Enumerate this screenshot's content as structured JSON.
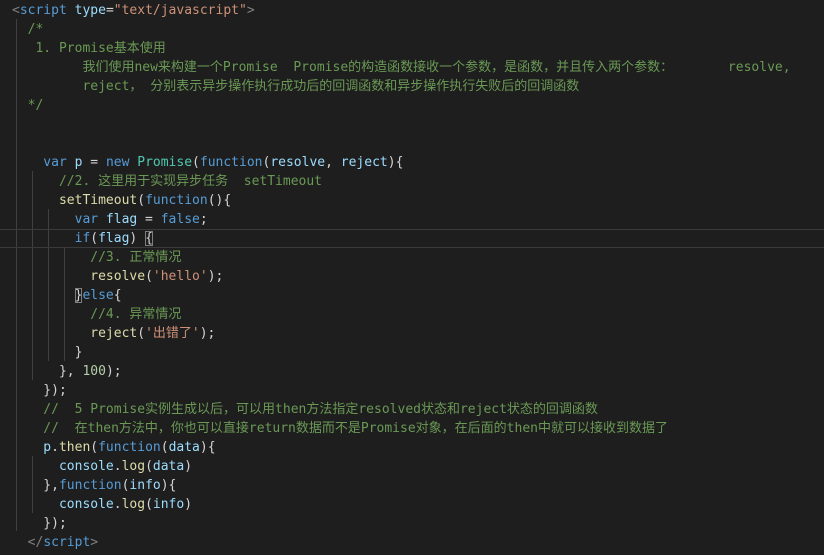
{
  "editor": {
    "language": "javascript",
    "theme": "dark",
    "colors": {
      "background": "#1e1e1e",
      "keyword": "#569cd6",
      "variable": "#9cdcfe",
      "function": "#dcdcaa",
      "class": "#4ec9b0",
      "string": "#ce9178",
      "number": "#b5cea8",
      "comment": "#6a9955",
      "text": "#d4d4d4"
    },
    "lines": [
      {
        "n": 1,
        "tokens": [
          [
            "tk-punc",
            "<"
          ],
          [
            "tk-tag",
            "script"
          ],
          [
            "tk-plain",
            " "
          ],
          [
            "tk-attr",
            "type"
          ],
          [
            "tk-plain",
            "="
          ],
          [
            "tk-str",
            "\"text/javascript\""
          ],
          [
            "tk-punc",
            ">"
          ]
        ]
      },
      {
        "n": 2,
        "tokens": [
          [
            "tk-cmt",
            "  /*"
          ]
        ]
      },
      {
        "n": 3,
        "tokens": [
          [
            "tk-cmt",
            "   1. Promise基本使用"
          ]
        ]
      },
      {
        "n": 4,
        "tokens": [
          [
            "tk-cmt",
            "         我们使用new来构建一个Promise  Promise的构造函数接收一个参数，是函数，并且传入两个参数：       resolve,"
          ]
        ]
      },
      {
        "n": 5,
        "tokens": [
          [
            "tk-cmt",
            "         reject， 分别表示异步操作执行成功后的回调函数和异步操作执行失败后的回调函数"
          ]
        ]
      },
      {
        "n": 6,
        "tokens": [
          [
            "tk-cmt",
            "  */"
          ]
        ]
      },
      {
        "n": 7,
        "tokens": []
      },
      {
        "n": 8,
        "tokens": []
      },
      {
        "n": 9,
        "tokens": [
          [
            "tk-kw",
            "    var"
          ],
          [
            "tk-plain",
            " "
          ],
          [
            "tk-var",
            "p"
          ],
          [
            "tk-plain",
            " = "
          ],
          [
            "tk-kw",
            "new"
          ],
          [
            "tk-plain",
            " "
          ],
          [
            "tk-cls",
            "Promise"
          ],
          [
            "tk-plain",
            "("
          ],
          [
            "tk-kw",
            "function"
          ],
          [
            "tk-plain",
            "("
          ],
          [
            "tk-var",
            "resolve"
          ],
          [
            "tk-plain",
            ", "
          ],
          [
            "tk-var",
            "reject"
          ],
          [
            "tk-plain",
            "){"
          ]
        ]
      },
      {
        "n": 10,
        "tokens": [
          [
            "tk-cmt",
            "      //2. 这里用于实现异步任务  setTimeout"
          ]
        ]
      },
      {
        "n": 11,
        "tokens": [
          [
            "tk-fn",
            "      setTimeout"
          ],
          [
            "tk-plain",
            "("
          ],
          [
            "tk-kw",
            "function"
          ],
          [
            "tk-plain",
            "(){"
          ]
        ]
      },
      {
        "n": 12,
        "tokens": [
          [
            "tk-kw",
            "        var"
          ],
          [
            "tk-plain",
            " "
          ],
          [
            "tk-var",
            "flag"
          ],
          [
            "tk-plain",
            " = "
          ],
          [
            "tk-bool",
            "false"
          ],
          [
            "tk-plain",
            ";"
          ]
        ]
      },
      {
        "n": 13,
        "current": true,
        "tokens": [
          [
            "tk-kw",
            "        if"
          ],
          [
            "tk-plain",
            "("
          ],
          [
            "tk-var",
            "flag"
          ],
          [
            "tk-plain",
            ") "
          ],
          [
            "tk-plain box",
            "{"
          ]
        ]
      },
      {
        "n": 14,
        "tokens": [
          [
            "tk-cmt",
            "          //3. 正常情况"
          ]
        ]
      },
      {
        "n": 15,
        "tokens": [
          [
            "tk-fn",
            "          resolve"
          ],
          [
            "tk-plain",
            "("
          ],
          [
            "tk-str",
            "'hello'"
          ],
          [
            "tk-plain",
            ");"
          ]
        ]
      },
      {
        "n": 16,
        "tokens": [
          [
            "tk-plain",
            "        "
          ],
          [
            "tk-plain box",
            "}"
          ],
          [
            "tk-kw",
            "else"
          ],
          [
            "tk-plain",
            "{"
          ]
        ]
      },
      {
        "n": 17,
        "tokens": [
          [
            "tk-cmt",
            "          //4. 异常情况"
          ]
        ]
      },
      {
        "n": 18,
        "tokens": [
          [
            "tk-fn",
            "          reject"
          ],
          [
            "tk-plain",
            "("
          ],
          [
            "tk-str",
            "'出错了'"
          ],
          [
            "tk-plain",
            ");"
          ]
        ]
      },
      {
        "n": 19,
        "tokens": [
          [
            "tk-plain",
            "        }"
          ]
        ]
      },
      {
        "n": 20,
        "tokens": [
          [
            "tk-plain",
            "      }, "
          ],
          [
            "tk-num",
            "100"
          ],
          [
            "tk-plain",
            ");"
          ]
        ]
      },
      {
        "n": 21,
        "tokens": [
          [
            "tk-plain",
            "    });"
          ]
        ]
      },
      {
        "n": 22,
        "tokens": [
          [
            "tk-cmt",
            "    //  5 Promise实例生成以后，可以用then方法指定resolved状态和reject状态的回调函数"
          ]
        ]
      },
      {
        "n": 23,
        "tokens": [
          [
            "tk-cmt",
            "    //  在then方法中，你也可以直接return数据而不是Promise对象，在后面的then中就可以接收到数据了"
          ]
        ]
      },
      {
        "n": 24,
        "tokens": [
          [
            "tk-var",
            "    p"
          ],
          [
            "tk-plain",
            "."
          ],
          [
            "tk-fn",
            "then"
          ],
          [
            "tk-plain",
            "("
          ],
          [
            "tk-kw",
            "function"
          ],
          [
            "tk-plain",
            "("
          ],
          [
            "tk-var",
            "data"
          ],
          [
            "tk-plain",
            "){"
          ]
        ]
      },
      {
        "n": 25,
        "tokens": [
          [
            "tk-var",
            "      console"
          ],
          [
            "tk-plain",
            "."
          ],
          [
            "tk-fn",
            "log"
          ],
          [
            "tk-plain",
            "("
          ],
          [
            "tk-var",
            "data"
          ],
          [
            "tk-plain",
            ")"
          ]
        ]
      },
      {
        "n": 26,
        "tokens": [
          [
            "tk-plain",
            "    },"
          ],
          [
            "tk-kw",
            "function"
          ],
          [
            "tk-plain",
            "("
          ],
          [
            "tk-var",
            "info"
          ],
          [
            "tk-plain",
            "){"
          ]
        ]
      },
      {
        "n": 27,
        "tokens": [
          [
            "tk-var",
            "      console"
          ],
          [
            "tk-plain",
            "."
          ],
          [
            "tk-fn",
            "log"
          ],
          [
            "tk-plain",
            "("
          ],
          [
            "tk-var",
            "info"
          ],
          [
            "tk-plain",
            ")"
          ]
        ]
      },
      {
        "n": 28,
        "tokens": [
          [
            "tk-plain",
            "    });"
          ]
        ]
      },
      {
        "n": 29,
        "tokens": [
          [
            "tk-punc",
            "  </"
          ],
          [
            "tk-tag",
            "script"
          ],
          [
            "tk-punc",
            ">"
          ]
        ]
      }
    ]
  }
}
